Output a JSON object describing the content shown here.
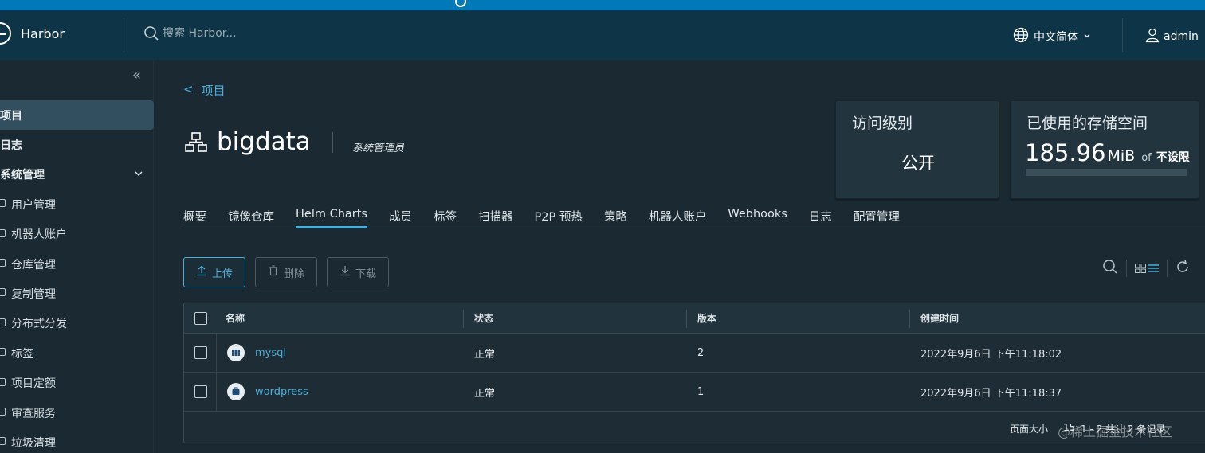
{
  "header": {
    "app_title": "Harbor",
    "search_placeholder": "搜索 Harbor...",
    "language": "中文简体",
    "user": "admin"
  },
  "sidebar": {
    "items": [
      {
        "label": "项目",
        "active": true
      },
      {
        "label": "日志"
      },
      {
        "label": "系统管理"
      },
      {
        "label": "用户管理"
      },
      {
        "label": "机器人账户"
      },
      {
        "label": "仓库管理"
      },
      {
        "label": "复制管理"
      },
      {
        "label": "分布式分发"
      },
      {
        "label": "标签"
      },
      {
        "label": "项目定额"
      },
      {
        "label": "审查服务"
      },
      {
        "label": "垃圾清理"
      }
    ]
  },
  "project": {
    "back_label": "项目",
    "name": "bigdata",
    "role": "系统管理员"
  },
  "cards": {
    "access_title": "访问级别",
    "access_value": "公开",
    "storage_title": "已使用的存储空间",
    "storage_value": "185.96",
    "storage_unit": "MiB",
    "storage_of": "of",
    "storage_limit": "不设限"
  },
  "tabs": [
    {
      "label": "概要"
    },
    {
      "label": "镜像仓库"
    },
    {
      "label": "Helm Charts",
      "active": true
    },
    {
      "label": "成员"
    },
    {
      "label": "标签"
    },
    {
      "label": "扫描器"
    },
    {
      "label": "P2P 预热"
    },
    {
      "label": "策略"
    },
    {
      "label": "机器人账户"
    },
    {
      "label": "Webhooks"
    },
    {
      "label": "日志"
    },
    {
      "label": "配置管理"
    }
  ],
  "toolbar": {
    "upload_label": "上传",
    "delete_label": "删除",
    "download_label": "下载"
  },
  "table": {
    "columns": [
      "名称",
      "状态",
      "版本",
      "创建时间"
    ],
    "rows": [
      {
        "name": "mysql",
        "status": "正常",
        "version": "2",
        "created": "2022年9月6日 下午11:18:02"
      },
      {
        "name": "wordpress",
        "status": "正常",
        "version": "1",
        "created": "2022年9月6日 下午11:18:37"
      }
    ],
    "page_size_label": "页面大小",
    "page_size": "15",
    "count_text": "1 - 2 共计 2 条记录"
  },
  "watermark": "@稀土掘金技术社区",
  "colors": {
    "accent": "#49afd9",
    "header_bg": "#0d3447",
    "page_bg": "#1b2a32"
  }
}
